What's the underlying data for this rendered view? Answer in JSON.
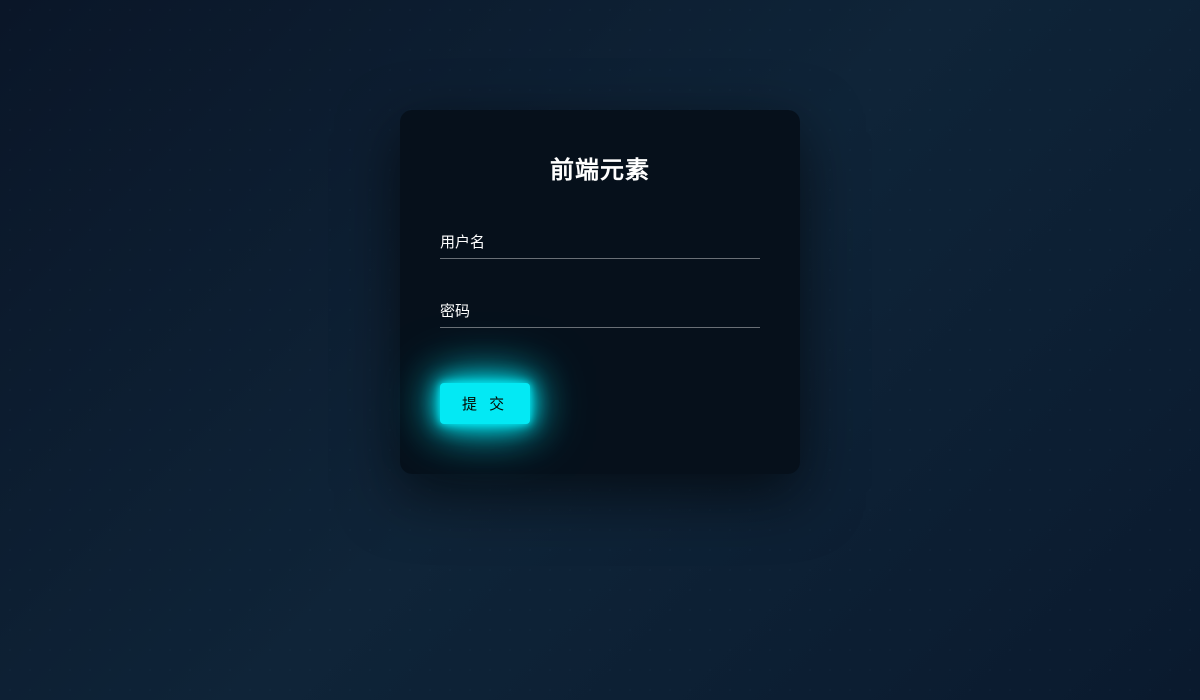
{
  "card": {
    "title": "前端元素"
  },
  "form": {
    "username": {
      "label": "用户名",
      "value": ""
    },
    "password": {
      "label": "密码",
      "value": ""
    },
    "submit_label": "提 交"
  },
  "colors": {
    "accent": "#03e9f4",
    "background": "#0a1628",
    "card_bg": "rgba(5, 15, 25, 0.92)"
  }
}
